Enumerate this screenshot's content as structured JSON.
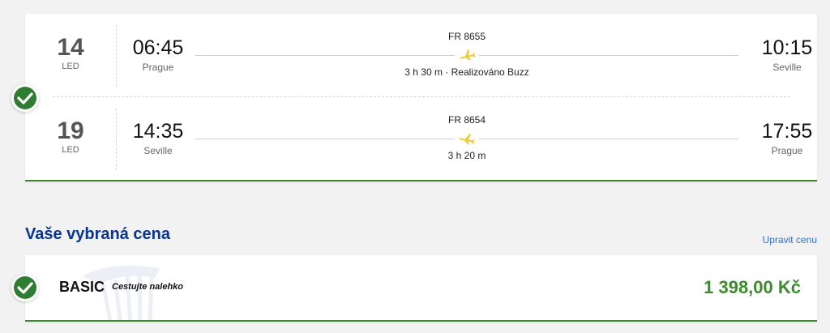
{
  "outbound": {
    "day": "14",
    "month": "LED",
    "departure_time": "06:45",
    "departure_city": "Prague",
    "flight_number": "FR 8655",
    "duration": "3 h 30 m · Realizováno Buzz",
    "arrival_time": "10:15",
    "arrival_city": "Seville"
  },
  "return": {
    "day": "19",
    "month": "LED",
    "departure_time": "14:35",
    "departure_city": "Seville",
    "flight_number": "FR 8654",
    "duration": "3 h 20 m",
    "arrival_time": "17:55",
    "arrival_city": "Prague"
  },
  "fare_section": {
    "title": "Vaše vybraná cena",
    "change_link": "Upravit cenu",
    "fare_name": "BASIC",
    "fare_tagline": "Cestujte nalehko",
    "price": "1 398,00 Kč"
  },
  "icons": {
    "selected": "check-circle-icon",
    "plane": "plane-icon",
    "watermark": "harp-logo-watermark"
  },
  "colors": {
    "accent_green": "#3c8b2b",
    "check_green": "#2e7d32",
    "title_blue": "#073590",
    "link_blue": "#2f70c8",
    "plane_yellow": "#f1c933"
  }
}
